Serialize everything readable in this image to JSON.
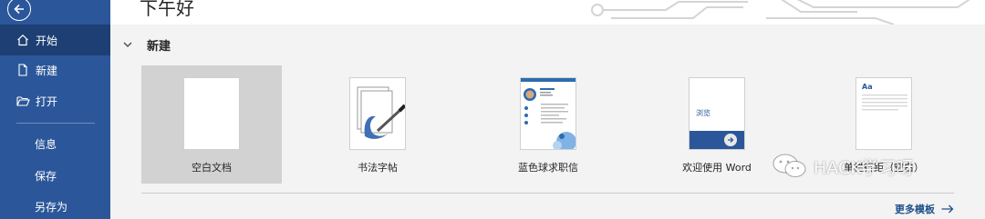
{
  "header": {
    "greeting": "下午好"
  },
  "sidebar": {
    "items": [
      {
        "label": "开始",
        "icon": "home-icon",
        "active": true
      },
      {
        "label": "新建",
        "icon": "new-document-icon"
      },
      {
        "label": "打开",
        "icon": "open-folder-icon"
      },
      {
        "label": "信息"
      },
      {
        "label": "保存"
      },
      {
        "label": "另存为"
      }
    ]
  },
  "new_section": {
    "title": "新建",
    "templates": [
      {
        "label": "空白文档",
        "selected": true
      },
      {
        "label": "书法字帖"
      },
      {
        "label": "蓝色球求职信"
      },
      {
        "label": "欢迎使用 Word",
        "thumb_text": "浏览"
      },
      {
        "label": "单栏行距（空白）",
        "thumb_text": "Aa"
      }
    ],
    "more_label": "更多模板"
  },
  "watermark": {
    "text": "HACK学习呀"
  },
  "colors": {
    "sidebar": "#2b579a",
    "sidebar_active": "#1e3f73",
    "background": "#f3f3f3",
    "link": "#1e4e8c"
  }
}
